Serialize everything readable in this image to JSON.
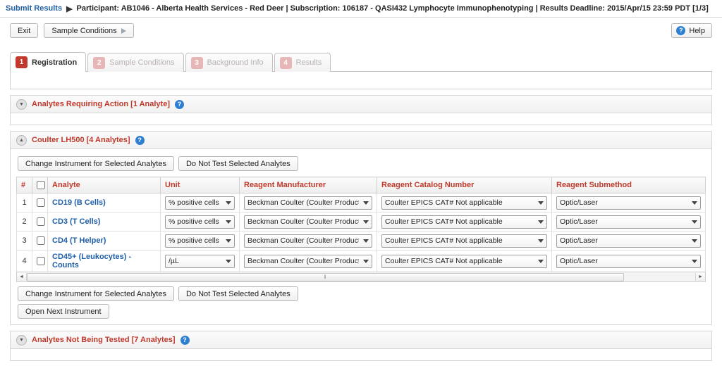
{
  "breadcrumb": {
    "link": "Submit Results",
    "separator": "▶",
    "detail": "Participant: AB1046 - Alberta Health Services - Red Deer | Subscription: 106187 - QASI432 Lymphocyte Immunophenotyping | Results Deadline: 2015/Apr/15 23:59 PDT [1/3]"
  },
  "toolbar": {
    "exit_label": "Exit",
    "sample_conditions_label": "Sample Conditions",
    "help_label": "Help"
  },
  "tabs": [
    {
      "num": "1",
      "label": "Registration",
      "active": true
    },
    {
      "num": "2",
      "label": "Sample Conditions",
      "active": false
    },
    {
      "num": "3",
      "label": "Background Info",
      "active": false
    },
    {
      "num": "4",
      "label": "Results",
      "active": false
    }
  ],
  "sections": {
    "analytes_requiring_action": "Analytes Requiring Action [1 Analyte]",
    "coulter": "Coulter LH500 [4 Analytes]",
    "analytes_not_tested": "Analytes Not Being Tested [7 Analytes]"
  },
  "buttons": {
    "change_instrument": "Change Instrument for Selected Analytes",
    "do_not_test": "Do Not Test Selected Analytes",
    "open_next_instrument": "Open Next Instrument"
  },
  "table": {
    "headers": [
      "#",
      "",
      "Analyte",
      "Unit",
      "Reagent Manufacturer",
      "Reagent Catalog Number",
      "Reagent Submethod"
    ],
    "rows": [
      {
        "num": "1",
        "analyte": "CD19 (B Cells)",
        "unit": "% positive cells",
        "manufacturer": "Beckman Coulter (Coulter Products",
        "catalog": "Coulter EPICS CAT# Not applicable",
        "submethod": "Optic/Laser"
      },
      {
        "num": "2",
        "analyte": "CD3 (T Cells)",
        "unit": "% positive cells",
        "manufacturer": "Beckman Coulter (Coulter Products",
        "catalog": "Coulter EPICS CAT# Not applicable",
        "submethod": "Optic/Laser"
      },
      {
        "num": "3",
        "analyte": "CD4 (T Helper)",
        "unit": "% positive cells",
        "manufacturer": "Beckman Coulter (Coulter Products",
        "catalog": "Coulter EPICS CAT# Not applicable",
        "submethod": "Optic/Laser"
      },
      {
        "num": "4",
        "analyte": "CD45+ (Leukocytes) - Counts",
        "unit": "/µL",
        "manufacturer": "Beckman Coulter (Coulter Products",
        "catalog": "Coulter EPICS CAT# Not applicable",
        "submethod": "Optic/Laser"
      }
    ]
  },
  "icons": {
    "help_circle": "?",
    "collapse": "▼",
    "expand": "▲",
    "scroll_left": "◄",
    "scroll_right": "►",
    "grip": "‖"
  },
  "colors": {
    "link": "#1f5fa8",
    "section_title": "#c0392b",
    "tab_active": "#c0392b",
    "help_blue": "#2f7fd0"
  }
}
